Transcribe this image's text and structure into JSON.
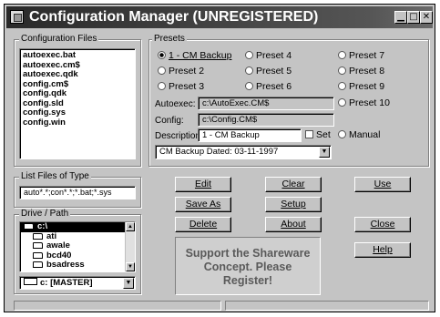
{
  "window": {
    "title": "Configuration Manager (UNREGISTERED)"
  },
  "config_files": {
    "label": "Configuration Files",
    "items": [
      "autoexec.bat",
      "autoexec.cm$",
      "autoexec.qdk",
      "config.cm$",
      "config.qdk",
      "config.sld",
      "config.sys",
      "config.win"
    ]
  },
  "presets": {
    "label": "Presets",
    "options": [
      {
        "label": "1 - CM Backup",
        "selected": true
      },
      {
        "label": "Preset 4",
        "selected": false
      },
      {
        "label": "Preset 7",
        "selected": false
      },
      {
        "label": "Preset 2",
        "selected": false
      },
      {
        "label": "Preset 5",
        "selected": false
      },
      {
        "label": "Preset 8",
        "selected": false
      },
      {
        "label": "Preset 3",
        "selected": false
      },
      {
        "label": "Preset 6",
        "selected": false
      },
      {
        "label": "Preset 9",
        "selected": false
      },
      {
        "label": "Preset 10",
        "selected": false
      }
    ],
    "autoexec_label": "Autoexec:",
    "autoexec_value": "c:\\AutoExec.CM$",
    "config_label": "Config:",
    "config_value": "c:\\Config.CM$",
    "description_label": "Description:",
    "description_value": "1 - CM Backup",
    "set_label": "Set",
    "manual_label": "Manual",
    "dropdown_value": "CM Backup Dated: 03-11-1997"
  },
  "file_types": {
    "label": "List Files of Type",
    "value": "auto*.*;con*.*;*.bat;*.sys"
  },
  "drive_path": {
    "label": "Drive / Path",
    "dirs": [
      "c:\\",
      "ati",
      "awale",
      "bcd40",
      "bsadress"
    ],
    "drive_value": "c: [MASTER]"
  },
  "buttons": {
    "edit": "Edit",
    "clear": "Clear",
    "use": "Use",
    "save_as": "Save As",
    "setup": "Setup",
    "delete": "Delete",
    "about": "About",
    "close": "Close",
    "help": "Help"
  },
  "shareware": {
    "line1": "Support the Shareware",
    "line2": "Concept.  Please",
    "line3": "Register!"
  },
  "colors": {
    "titlebar": "#3a3a3a",
    "window_bg": "#c4c4c4",
    "selection": "#000000"
  }
}
